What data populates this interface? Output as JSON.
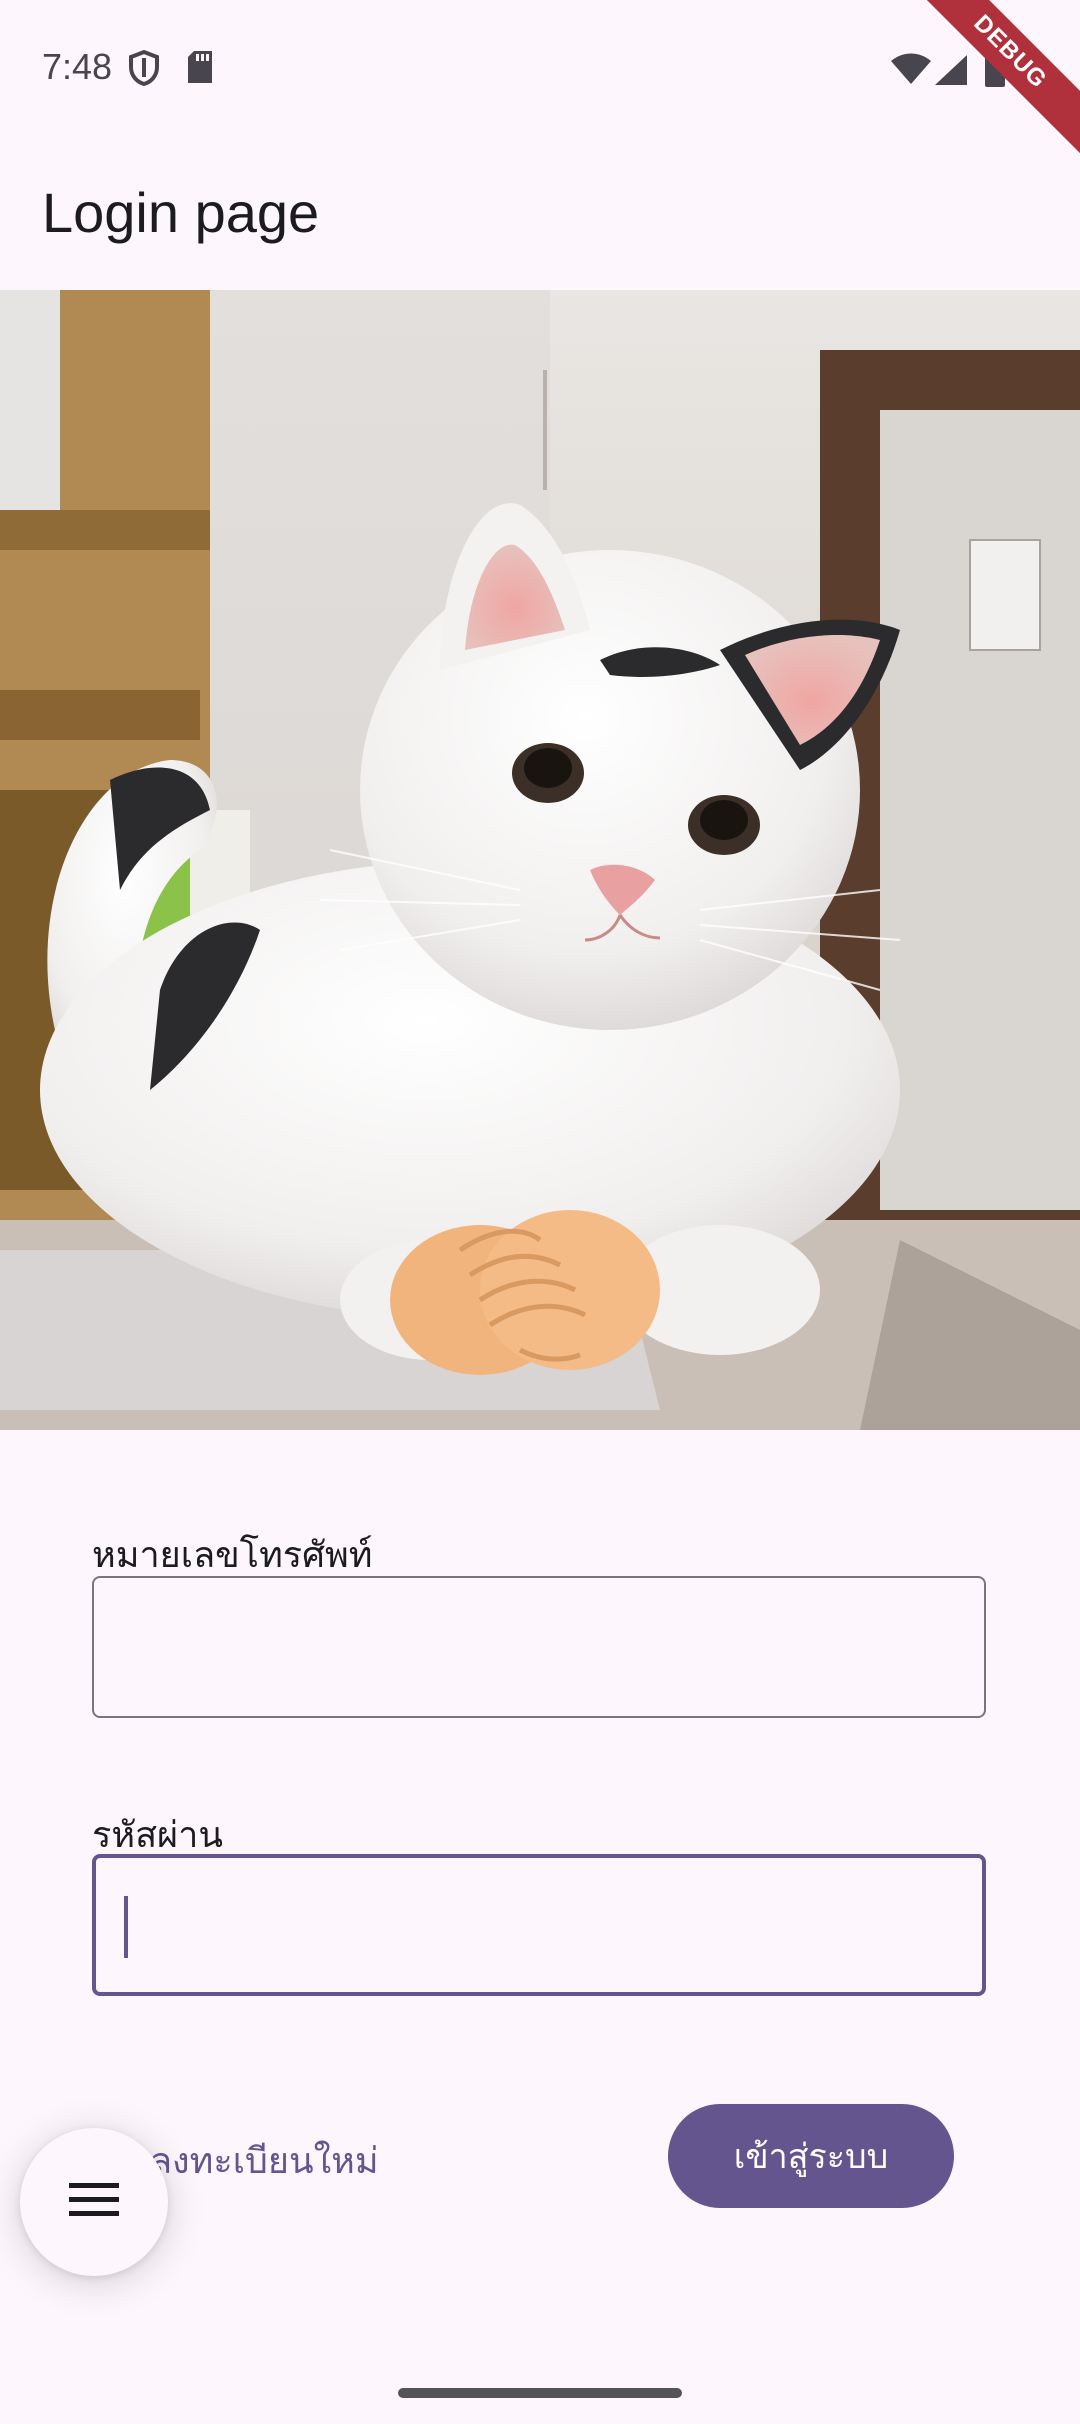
{
  "status_bar": {
    "time": "7:48",
    "left_icons": [
      "shield-icon",
      "sd-card-icon"
    ],
    "right_icons": [
      "wifi-icon",
      "cell-signal-icon",
      "battery-icon"
    ],
    "debug_banner": "DEBUG"
  },
  "app_bar": {
    "title": "Login page"
  },
  "hero_image": {
    "subject": "white cat with black patches and tiny human hands"
  },
  "form": {
    "phone_label": "หมายเลขโทรศัพท์",
    "phone_value": "",
    "password_label": "รหัสผ่าน",
    "password_value": ""
  },
  "actions": {
    "register_label": "ลงทะเบียนใหม่",
    "login_label": "เข้าสู่ระบบ",
    "fab_icon": "menu-icon"
  },
  "colors": {
    "background": "#fdf7fd",
    "primary": "#65558f",
    "outline": "#79747e",
    "debug": "#b0313b"
  }
}
